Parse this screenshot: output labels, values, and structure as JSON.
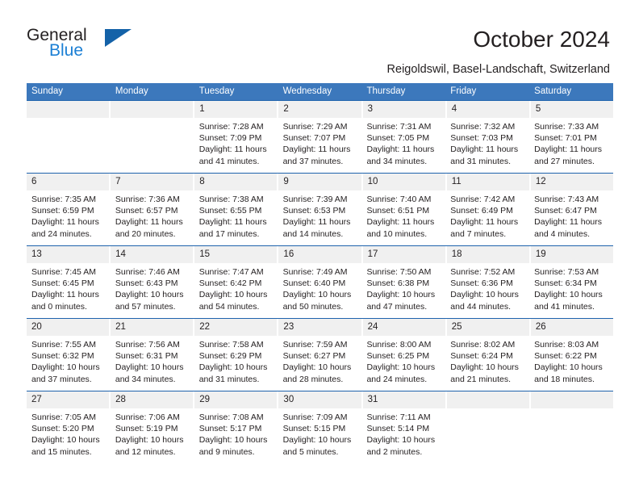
{
  "brand": {
    "line1": "General",
    "line2": "Blue",
    "flag_color": "#1462a8",
    "accent_color": "#1b7fd4"
  },
  "header": {
    "title": "October 2024",
    "location": "Reigoldswil, Basel-Landschaft, Switzerland"
  },
  "calendar": {
    "header_bg": "#3c78bc",
    "daynum_bg": "#f0f0f0",
    "separator_color": "#1f63ad",
    "weekday_labels": [
      "Sunday",
      "Monday",
      "Tuesday",
      "Wednesday",
      "Thursday",
      "Friday",
      "Saturday"
    ],
    "weeks": [
      [
        {
          "day": "",
          "sunrise": "",
          "sunset": "",
          "daylight_line1": "",
          "daylight_line2": ""
        },
        {
          "day": "",
          "sunrise": "",
          "sunset": "",
          "daylight_line1": "",
          "daylight_line2": ""
        },
        {
          "day": "1",
          "sunrise": "Sunrise: 7:28 AM",
          "sunset": "Sunset: 7:09 PM",
          "daylight_line1": "Daylight: 11 hours",
          "daylight_line2": "and 41 minutes."
        },
        {
          "day": "2",
          "sunrise": "Sunrise: 7:29 AM",
          "sunset": "Sunset: 7:07 PM",
          "daylight_line1": "Daylight: 11 hours",
          "daylight_line2": "and 37 minutes."
        },
        {
          "day": "3",
          "sunrise": "Sunrise: 7:31 AM",
          "sunset": "Sunset: 7:05 PM",
          "daylight_line1": "Daylight: 11 hours",
          "daylight_line2": "and 34 minutes."
        },
        {
          "day": "4",
          "sunrise": "Sunrise: 7:32 AM",
          "sunset": "Sunset: 7:03 PM",
          "daylight_line1": "Daylight: 11 hours",
          "daylight_line2": "and 31 minutes."
        },
        {
          "day": "5",
          "sunrise": "Sunrise: 7:33 AM",
          "sunset": "Sunset: 7:01 PM",
          "daylight_line1": "Daylight: 11 hours",
          "daylight_line2": "and 27 minutes."
        }
      ],
      [
        {
          "day": "6",
          "sunrise": "Sunrise: 7:35 AM",
          "sunset": "Sunset: 6:59 PM",
          "daylight_line1": "Daylight: 11 hours",
          "daylight_line2": "and 24 minutes."
        },
        {
          "day": "7",
          "sunrise": "Sunrise: 7:36 AM",
          "sunset": "Sunset: 6:57 PM",
          "daylight_line1": "Daylight: 11 hours",
          "daylight_line2": "and 20 minutes."
        },
        {
          "day": "8",
          "sunrise": "Sunrise: 7:38 AM",
          "sunset": "Sunset: 6:55 PM",
          "daylight_line1": "Daylight: 11 hours",
          "daylight_line2": "and 17 minutes."
        },
        {
          "day": "9",
          "sunrise": "Sunrise: 7:39 AM",
          "sunset": "Sunset: 6:53 PM",
          "daylight_line1": "Daylight: 11 hours",
          "daylight_line2": "and 14 minutes."
        },
        {
          "day": "10",
          "sunrise": "Sunrise: 7:40 AM",
          "sunset": "Sunset: 6:51 PM",
          "daylight_line1": "Daylight: 11 hours",
          "daylight_line2": "and 10 minutes."
        },
        {
          "day": "11",
          "sunrise": "Sunrise: 7:42 AM",
          "sunset": "Sunset: 6:49 PM",
          "daylight_line1": "Daylight: 11 hours",
          "daylight_line2": "and 7 minutes."
        },
        {
          "day": "12",
          "sunrise": "Sunrise: 7:43 AM",
          "sunset": "Sunset: 6:47 PM",
          "daylight_line1": "Daylight: 11 hours",
          "daylight_line2": "and 4 minutes."
        }
      ],
      [
        {
          "day": "13",
          "sunrise": "Sunrise: 7:45 AM",
          "sunset": "Sunset: 6:45 PM",
          "daylight_line1": "Daylight: 11 hours",
          "daylight_line2": "and 0 minutes."
        },
        {
          "day": "14",
          "sunrise": "Sunrise: 7:46 AM",
          "sunset": "Sunset: 6:43 PM",
          "daylight_line1": "Daylight: 10 hours",
          "daylight_line2": "and 57 minutes."
        },
        {
          "day": "15",
          "sunrise": "Sunrise: 7:47 AM",
          "sunset": "Sunset: 6:42 PM",
          "daylight_line1": "Daylight: 10 hours",
          "daylight_line2": "and 54 minutes."
        },
        {
          "day": "16",
          "sunrise": "Sunrise: 7:49 AM",
          "sunset": "Sunset: 6:40 PM",
          "daylight_line1": "Daylight: 10 hours",
          "daylight_line2": "and 50 minutes."
        },
        {
          "day": "17",
          "sunrise": "Sunrise: 7:50 AM",
          "sunset": "Sunset: 6:38 PM",
          "daylight_line1": "Daylight: 10 hours",
          "daylight_line2": "and 47 minutes."
        },
        {
          "day": "18",
          "sunrise": "Sunrise: 7:52 AM",
          "sunset": "Sunset: 6:36 PM",
          "daylight_line1": "Daylight: 10 hours",
          "daylight_line2": "and 44 minutes."
        },
        {
          "day": "19",
          "sunrise": "Sunrise: 7:53 AM",
          "sunset": "Sunset: 6:34 PM",
          "daylight_line1": "Daylight: 10 hours",
          "daylight_line2": "and 41 minutes."
        }
      ],
      [
        {
          "day": "20",
          "sunrise": "Sunrise: 7:55 AM",
          "sunset": "Sunset: 6:32 PM",
          "daylight_line1": "Daylight: 10 hours",
          "daylight_line2": "and 37 minutes."
        },
        {
          "day": "21",
          "sunrise": "Sunrise: 7:56 AM",
          "sunset": "Sunset: 6:31 PM",
          "daylight_line1": "Daylight: 10 hours",
          "daylight_line2": "and 34 minutes."
        },
        {
          "day": "22",
          "sunrise": "Sunrise: 7:58 AM",
          "sunset": "Sunset: 6:29 PM",
          "daylight_line1": "Daylight: 10 hours",
          "daylight_line2": "and 31 minutes."
        },
        {
          "day": "23",
          "sunrise": "Sunrise: 7:59 AM",
          "sunset": "Sunset: 6:27 PM",
          "daylight_line1": "Daylight: 10 hours",
          "daylight_line2": "and 28 minutes."
        },
        {
          "day": "24",
          "sunrise": "Sunrise: 8:00 AM",
          "sunset": "Sunset: 6:25 PM",
          "daylight_line1": "Daylight: 10 hours",
          "daylight_line2": "and 24 minutes."
        },
        {
          "day": "25",
          "sunrise": "Sunrise: 8:02 AM",
          "sunset": "Sunset: 6:24 PM",
          "daylight_line1": "Daylight: 10 hours",
          "daylight_line2": "and 21 minutes."
        },
        {
          "day": "26",
          "sunrise": "Sunrise: 8:03 AM",
          "sunset": "Sunset: 6:22 PM",
          "daylight_line1": "Daylight: 10 hours",
          "daylight_line2": "and 18 minutes."
        }
      ],
      [
        {
          "day": "27",
          "sunrise": "Sunrise: 7:05 AM",
          "sunset": "Sunset: 5:20 PM",
          "daylight_line1": "Daylight: 10 hours",
          "daylight_line2": "and 15 minutes."
        },
        {
          "day": "28",
          "sunrise": "Sunrise: 7:06 AM",
          "sunset": "Sunset: 5:19 PM",
          "daylight_line1": "Daylight: 10 hours",
          "daylight_line2": "and 12 minutes."
        },
        {
          "day": "29",
          "sunrise": "Sunrise: 7:08 AM",
          "sunset": "Sunset: 5:17 PM",
          "daylight_line1": "Daylight: 10 hours",
          "daylight_line2": "and 9 minutes."
        },
        {
          "day": "30",
          "sunrise": "Sunrise: 7:09 AM",
          "sunset": "Sunset: 5:15 PM",
          "daylight_line1": "Daylight: 10 hours",
          "daylight_line2": "and 5 minutes."
        },
        {
          "day": "31",
          "sunrise": "Sunrise: 7:11 AM",
          "sunset": "Sunset: 5:14 PM",
          "daylight_line1": "Daylight: 10 hours",
          "daylight_line2": "and 2 minutes."
        },
        {
          "day": "",
          "sunrise": "",
          "sunset": "",
          "daylight_line1": "",
          "daylight_line2": ""
        },
        {
          "day": "",
          "sunrise": "",
          "sunset": "",
          "daylight_line1": "",
          "daylight_line2": ""
        }
      ]
    ]
  }
}
